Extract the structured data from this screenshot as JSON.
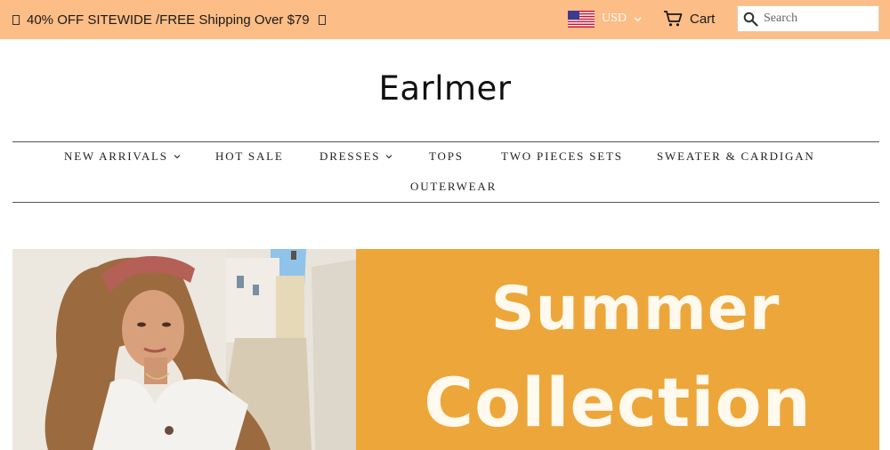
{
  "announcement": {
    "text": "40% OFF SITEWIDE /FREE Shipping Over $79",
    "bg_color": "#fcbd86"
  },
  "header": {
    "currency": {
      "code": "USD",
      "icon": "us-flag-icon"
    },
    "cart": {
      "label": "Cart",
      "icon": "cart-icon"
    },
    "search": {
      "placeholder": "Search",
      "icon": "search-icon"
    }
  },
  "logo": {
    "text": "Earlmer"
  },
  "nav": {
    "items": [
      {
        "label": "NEW ARRIVALS",
        "has_dropdown": true
      },
      {
        "label": "HOT SALE",
        "has_dropdown": false
      },
      {
        "label": "DRESSES",
        "has_dropdown": true
      },
      {
        "label": "TOPS",
        "has_dropdown": false
      },
      {
        "label": "TWO PIECES SETS",
        "has_dropdown": false
      },
      {
        "label": "SWEATER & CARDIGAN",
        "has_dropdown": false
      },
      {
        "label": "OUTERWEAR",
        "has_dropdown": false
      }
    ]
  },
  "banner": {
    "headline_line1": "Summer",
    "headline_line2": "Collection",
    "panel_color": "#eda63a"
  }
}
